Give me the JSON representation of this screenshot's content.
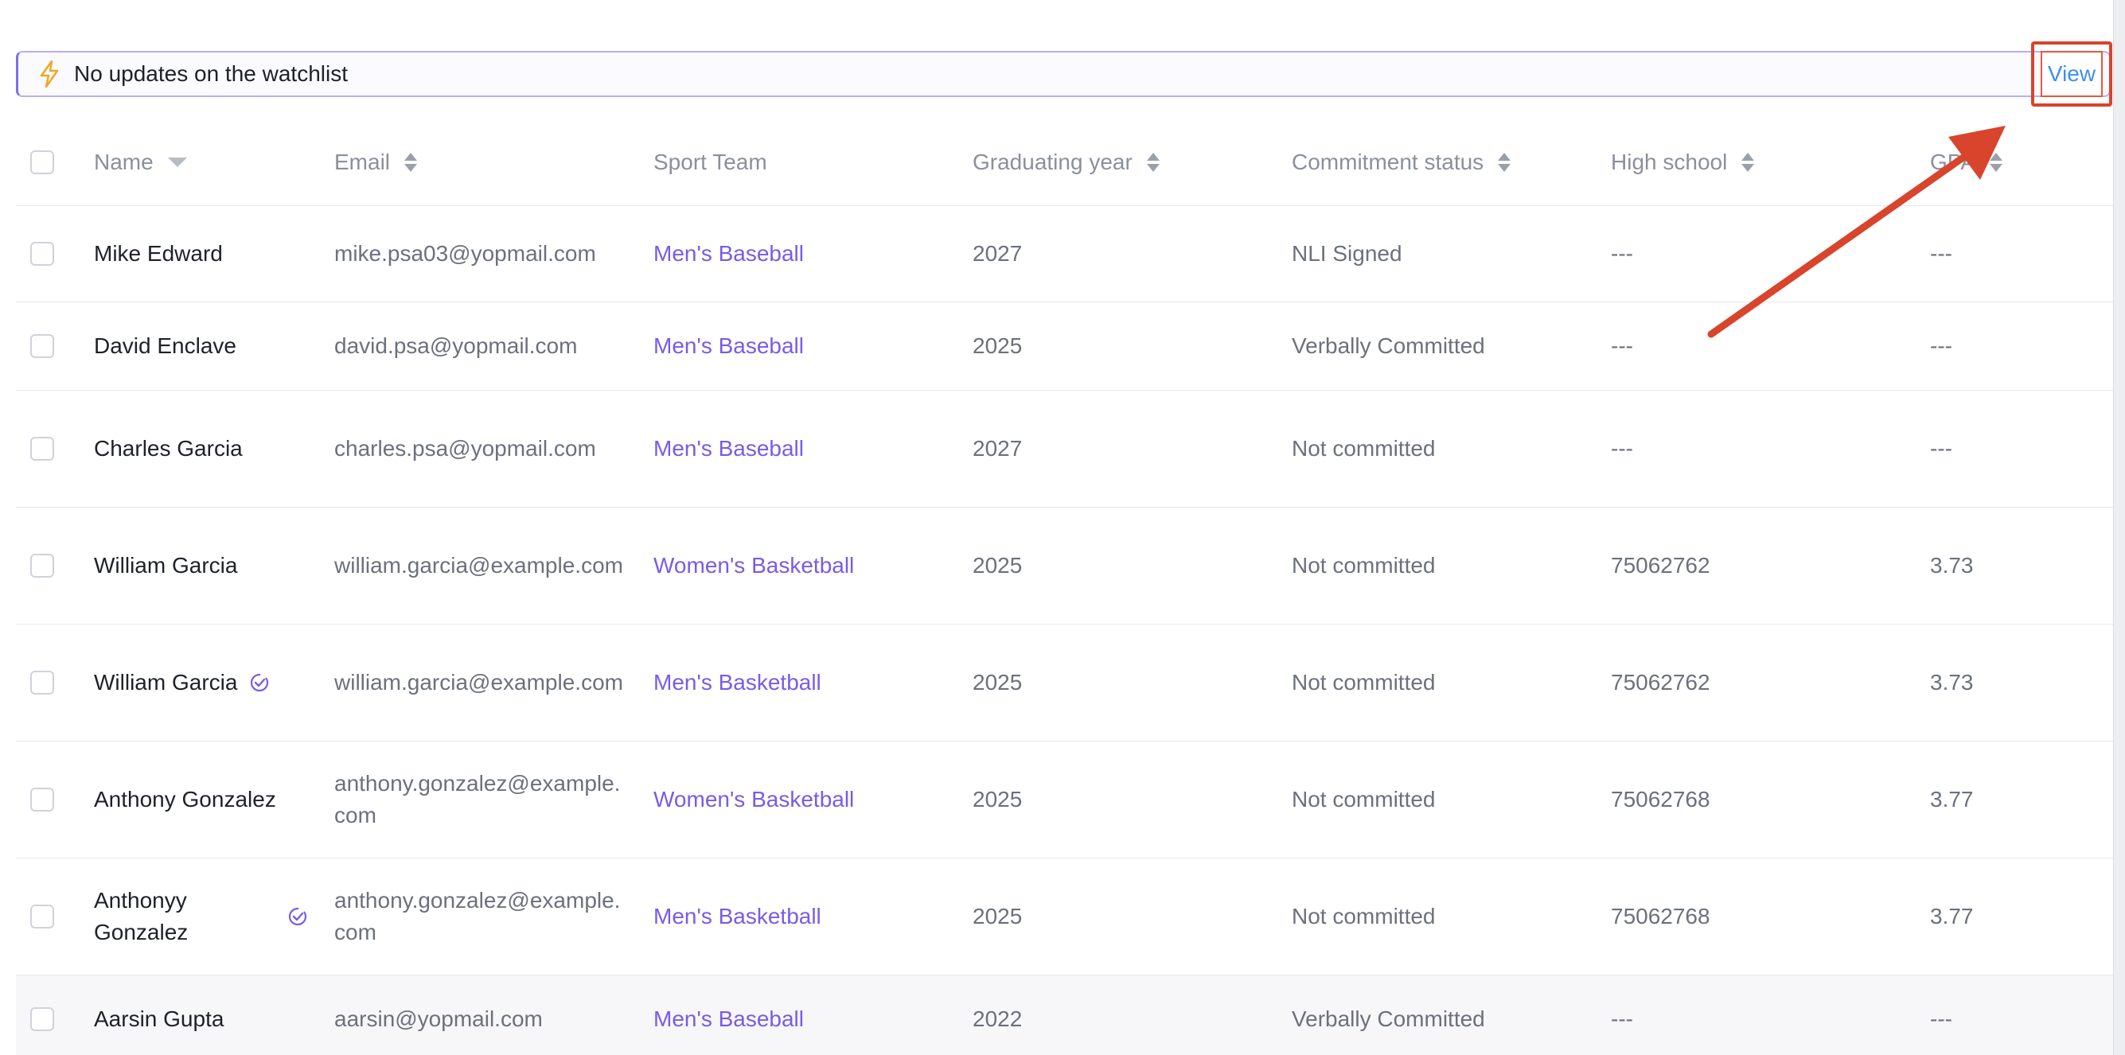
{
  "banner": {
    "icon": "lightning-bolt-icon",
    "text": "No updates on the watchlist",
    "view_label": "View",
    "accent": "#7c6df0"
  },
  "table": {
    "headers": {
      "name": "Name",
      "email": "Email",
      "sport_team": "Sport Team",
      "graduating_year": "Graduating year",
      "commitment_status": "Commitment status",
      "high_school": "High school",
      "gpa": "GPA"
    },
    "rows": [
      {
        "name": "Mike Edward",
        "synced": false,
        "email": "mike.psa03@yopmail.com",
        "team": "Men's Baseball",
        "year": "2027",
        "status": "NLI Signed",
        "school": "---",
        "gpa": "---"
      },
      {
        "name": "David Enclave",
        "synced": false,
        "email": "david.psa@yopmail.com",
        "team": "Men's Baseball",
        "year": "2025",
        "status": "Verbally Committed",
        "school": "---",
        "gpa": "---"
      },
      {
        "name": "Charles Garcia",
        "synced": false,
        "email": "charles.psa@yopmail.com",
        "team": "Men's Baseball",
        "year": "2027",
        "status": "Not committed",
        "school": "---",
        "gpa": "---"
      },
      {
        "name": "William Garcia",
        "synced": false,
        "email": "william.garcia@example.com",
        "team": "Women's Basketball",
        "year": "2025",
        "status": "Not committed",
        "school": "75062762",
        "gpa": "3.73"
      },
      {
        "name": "William Garcia",
        "synced": true,
        "email": "william.garcia@example.com",
        "team": "Men's Basketball",
        "year": "2025",
        "status": "Not committed",
        "school": "75062762",
        "gpa": "3.73"
      },
      {
        "name": "Anthony Gonzalez",
        "synced": false,
        "email": "anthony.gonzalez@example.com",
        "team": "Women's Basketball",
        "year": "2025",
        "status": "Not committed",
        "school": "75062768",
        "gpa": "3.77"
      },
      {
        "name": "Anthonyy Gonzalez",
        "synced": true,
        "email": "anthony.gonzalez@example.com",
        "team": "Men's Basketball",
        "year": "2025",
        "status": "Not committed",
        "school": "75062768",
        "gpa": "3.77"
      },
      {
        "name": "Aarsin Gupta",
        "synced": false,
        "email": "aarsin@yopmail.com",
        "team": "Men's Baseball",
        "year": "2022",
        "status": "Verbally Committed",
        "school": "---",
        "gpa": "---"
      }
    ]
  },
  "colors": {
    "team_link": "#7a5be6",
    "view_link": "#3f8ef0",
    "annotation": "#d8442c"
  }
}
